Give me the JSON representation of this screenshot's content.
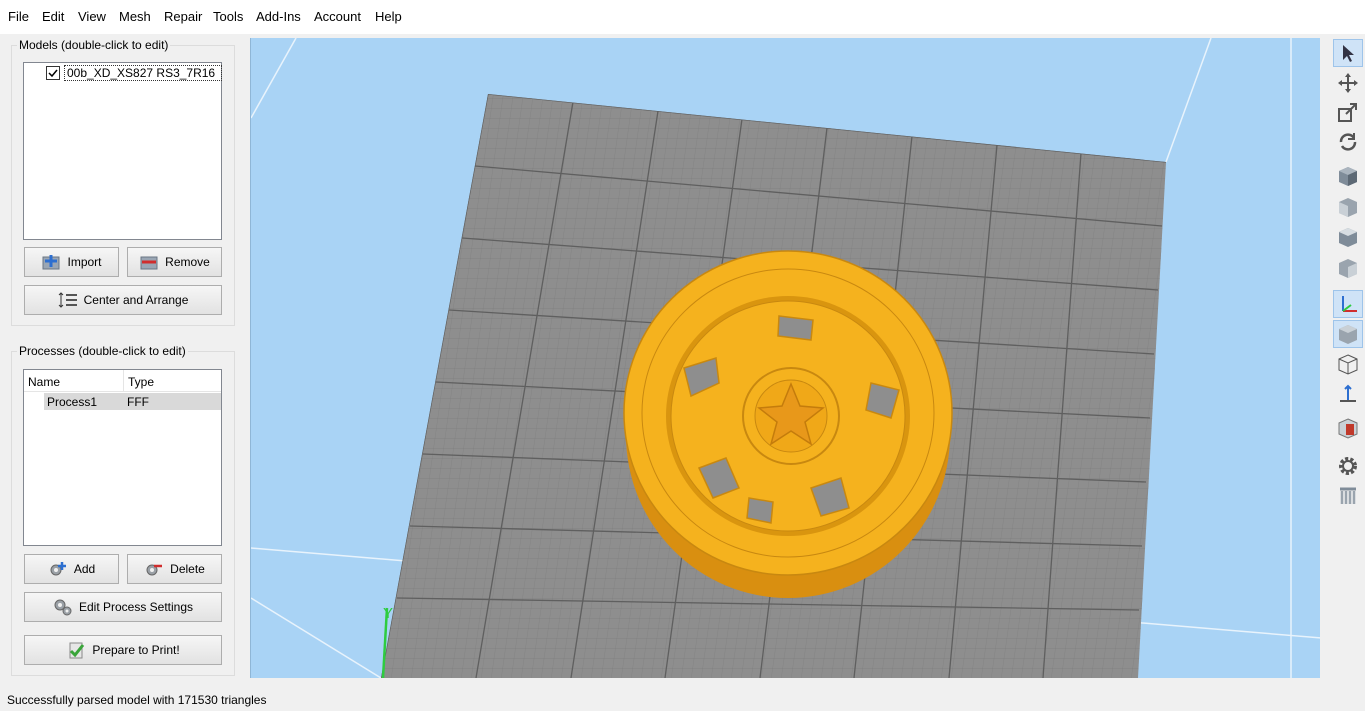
{
  "menu": [
    "File",
    "Edit",
    "View",
    "Mesh",
    "Repair",
    "Tools",
    "Add-Ins",
    "Account",
    "Help"
  ],
  "models_panel": {
    "title": "Models (double-click to edit)",
    "items": [
      {
        "name": "00b_XD_XS827 RS3_7R16",
        "checked": true
      }
    ],
    "import_label": "Import",
    "remove_label": "Remove",
    "center_arrange_label": "Center and Arrange"
  },
  "processes_panel": {
    "title": "Processes (double-click to edit)",
    "columns": [
      "Name",
      "Type"
    ],
    "rows": [
      {
        "name": "Process1",
        "type": "FFF"
      }
    ],
    "add_label": "Add",
    "delete_label": "Delete",
    "edit_settings_label": "Edit Process Settings",
    "prepare_label": "Prepare to Print!"
  },
  "viewport": {
    "background_color": "#a9d3f5",
    "bed_color": "#8e8e8e",
    "model_color": "#f5b21e",
    "axis_label": "Y"
  },
  "toolbar": {
    "tools": [
      "select-tool-icon",
      "move-tool-icon",
      "scale-tool-icon",
      "rotate-tool-icon",
      "view-iso-icon",
      "view-front-icon",
      "view-top-icon",
      "view-side-icon",
      "axis-toggle-icon",
      "solid-view-icon",
      "wireframe-view-icon",
      "normals-icon",
      "section-view-icon",
      "settings-gear-icon",
      "supports-icon"
    ]
  },
  "status": {
    "message": "Successfully parsed model with 171530 triangles"
  }
}
